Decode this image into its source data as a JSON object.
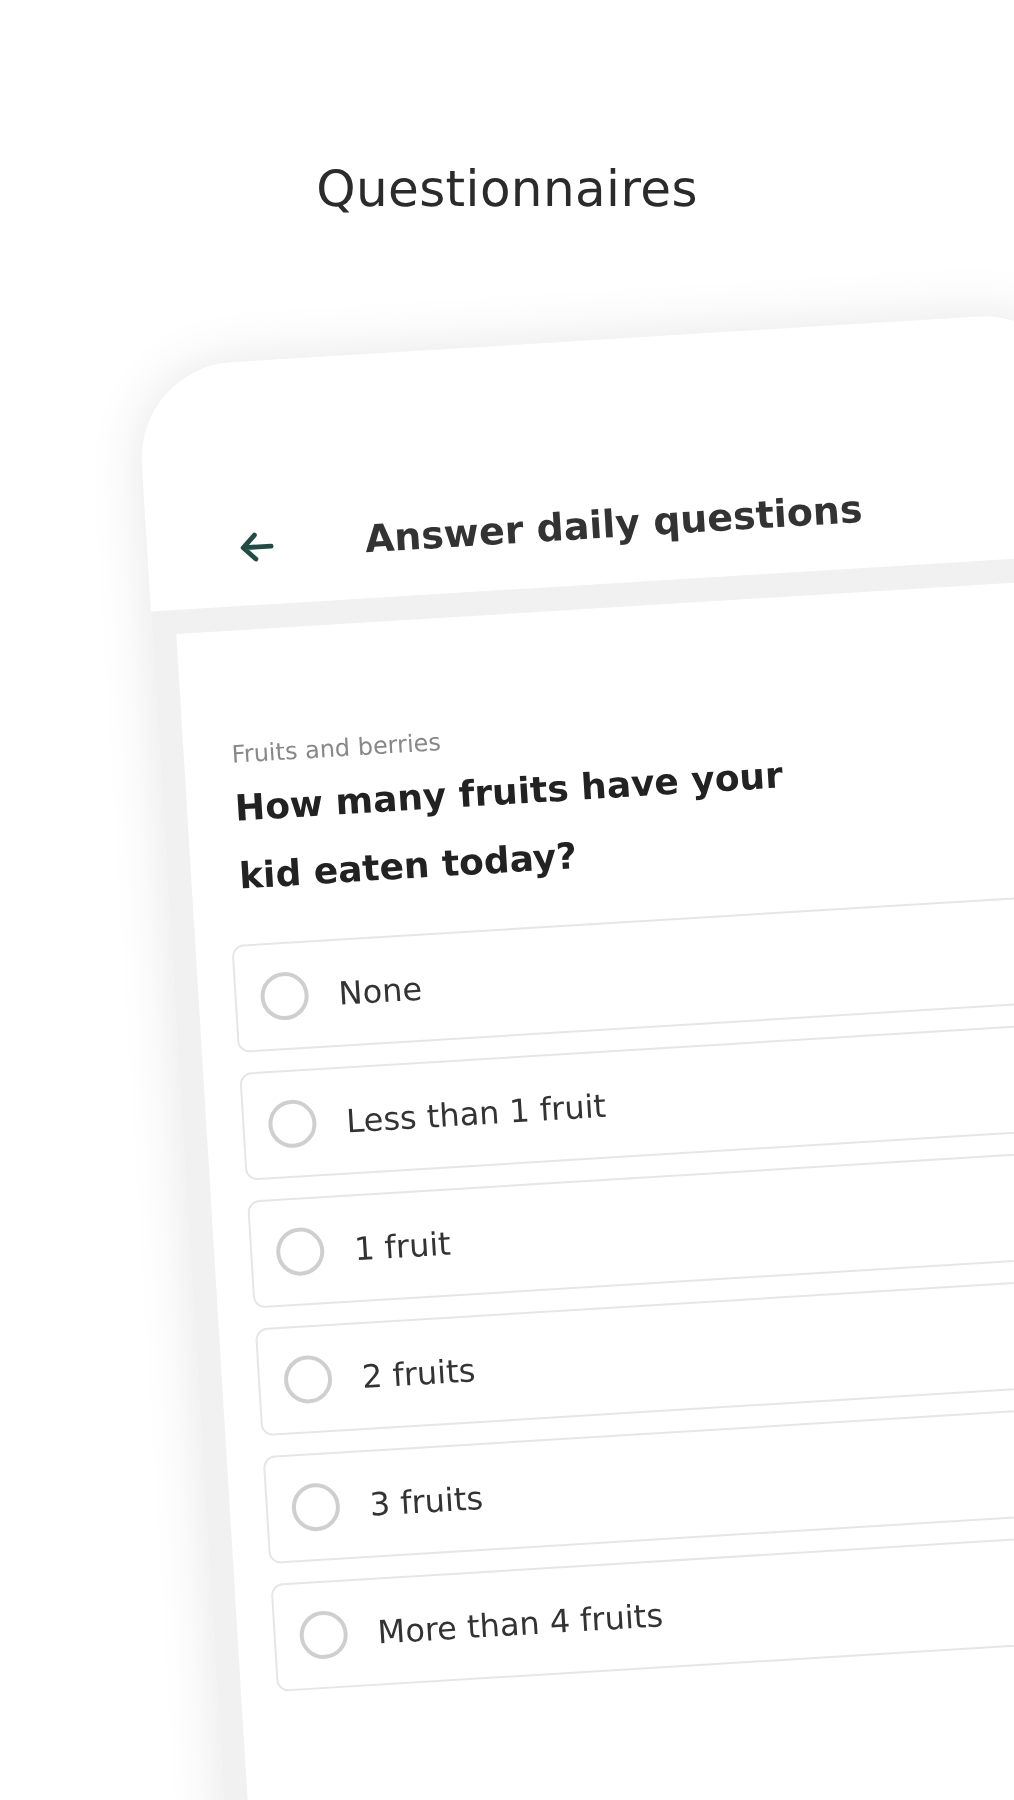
{
  "page_title": "Questionnaires",
  "screen": {
    "title": "Answer daily questions",
    "question": {
      "category": "Fruits and berries",
      "text": "How many fruits have your kid eaten today?",
      "options": [
        {
          "label": "None",
          "selected": false
        },
        {
          "label": "Less than 1 fruit",
          "selected": false
        },
        {
          "label": "1 fruit",
          "selected": false
        },
        {
          "label": "2 fruits",
          "selected": false
        },
        {
          "label": "3 fruits",
          "selected": false
        },
        {
          "label": "More than 4 fruits",
          "selected": false
        }
      ]
    }
  }
}
